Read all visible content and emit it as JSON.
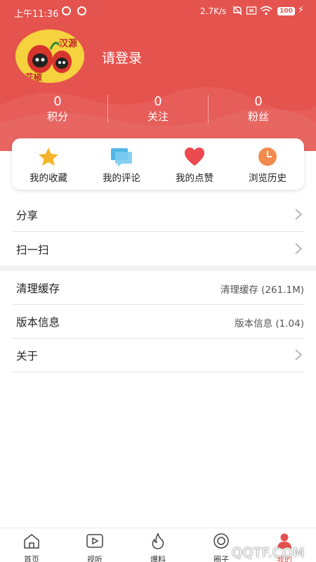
{
  "status_bar": {
    "time": "上午11:36",
    "network_speed": "2.7K/s",
    "battery": "100"
  },
  "profile": {
    "avatar_icon": "mascot-avatar",
    "avatar_text": "汉源 花椒",
    "login_prompt": "请登录"
  },
  "stats": [
    {
      "value": "0",
      "label": "积分"
    },
    {
      "value": "0",
      "label": "关注"
    },
    {
      "value": "0",
      "label": "粉丝"
    }
  ],
  "quick_actions": [
    {
      "label": "我的收藏",
      "icon": "star-icon",
      "color": "#f5b529"
    },
    {
      "label": "我的评论",
      "icon": "comment-icon",
      "color": "#4fb6e8"
    },
    {
      "label": "我的点赞",
      "icon": "heart-icon",
      "color": "#ec4a4f"
    },
    {
      "label": "浏览历史",
      "icon": "clock-icon",
      "color": "#f28b4e"
    }
  ],
  "menu": {
    "share": "分享",
    "scan": "扫一扫",
    "clear_cache": {
      "label": "清理缓存",
      "value": "清理缓存 (261.1M)"
    },
    "version": {
      "label": "版本信息",
      "value": "版本信息 (1.04)"
    },
    "about": "关于"
  },
  "tabs": [
    {
      "label": "首页",
      "icon": "home-icon"
    },
    {
      "label": "视听",
      "icon": "video-icon"
    },
    {
      "label": "爆料",
      "icon": "fire-icon"
    },
    {
      "label": "圈子",
      "icon": "circle-icon"
    },
    {
      "label": "我的",
      "icon": "person-icon",
      "active": true
    }
  ],
  "watermark": "QQTF.COM",
  "colors": {
    "accent": "#e5534f",
    "background": "#ffffff"
  }
}
